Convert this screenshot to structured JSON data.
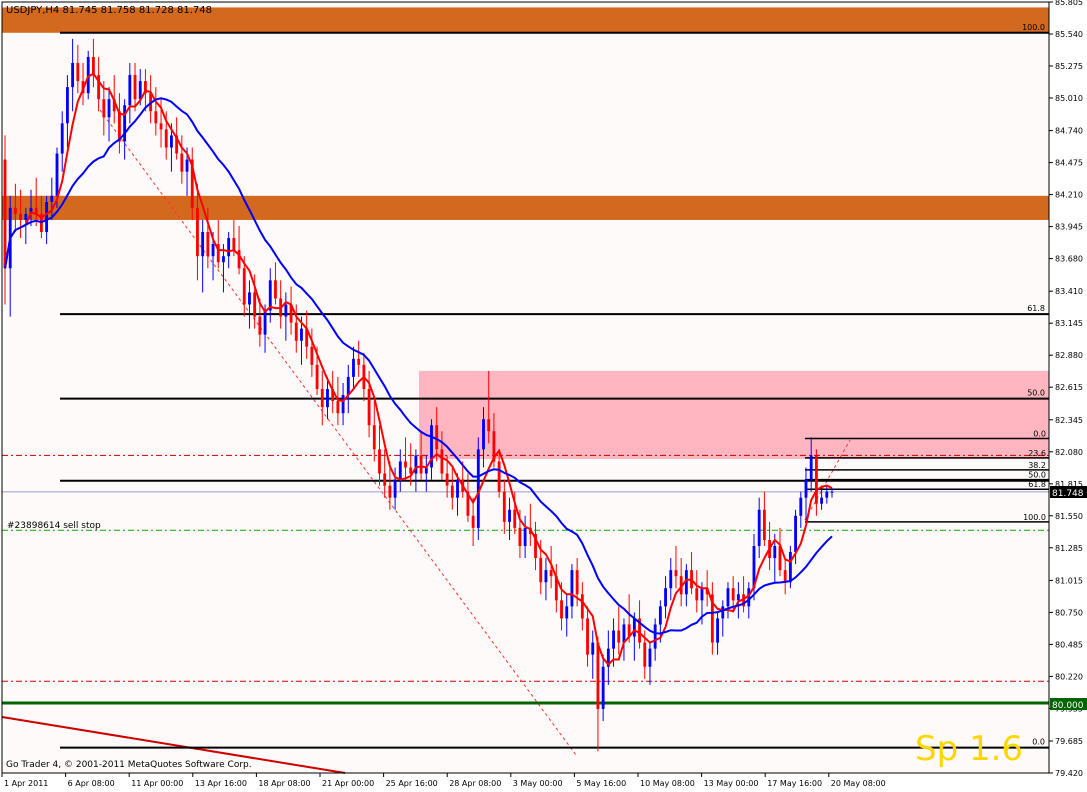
{
  "header": {
    "text": "USDJPY,H4  81.745 81.758 81.728 81.748"
  },
  "footer": {
    "text": "Go Trader 4, © 2001-2011 MetaQuotes Software Corp."
  },
  "watermark": {
    "text": "Sp 1.6"
  },
  "order_label": {
    "text": "#23898614 sell stop"
  },
  "current_price": {
    "text": "81.748"
  },
  "level_tag": {
    "text": "80.000"
  },
  "colors": {
    "background": "#fffafa",
    "bull": "#0000ff",
    "bear": "#ff0000",
    "ma_fast": "#ff0000",
    "ma_slow": "#0000ff",
    "zone_orange": "#d2691e",
    "zone_pink": "#ffb6c1",
    "support_green": "#006400",
    "watermark": "#ffd700"
  },
  "chart_data": {
    "type": "candlestick",
    "symbol": "USDJPY",
    "timeframe": "H4",
    "ylim": [
      79.42,
      85.805
    ],
    "y_ticks": [
      "85.805",
      "85.540",
      "85.275",
      "85.010",
      "84.740",
      "84.475",
      "84.210",
      "83.945",
      "83.680",
      "83.410",
      "83.145",
      "82.880",
      "82.615",
      "82.345",
      "82.080",
      "81.815",
      "81.550",
      "81.285",
      "81.015",
      "80.750",
      "80.485",
      "80.220",
      "79.955",
      "79.685",
      "79.420"
    ],
    "x_ticks": [
      "1 Apr 2011",
      "6 Apr 08:00",
      "11 Apr 00:00",
      "13 Apr 16:00",
      "18 Apr 08:00",
      "21 Apr 00:00",
      "25 Apr 16:00",
      "28 Apr 08:00",
      "3 May 00:00",
      "5 May 16:00",
      "10 May 08:00",
      "13 May 00:00",
      "17 May 16:00",
      "20 May 08:00"
    ],
    "ohlc": [
      [
        84.5,
        84.7,
        83.3,
        83.6
      ],
      [
        83.6,
        84.2,
        83.2,
        84.1
      ],
      [
        84.1,
        84.3,
        83.9,
        84.05
      ],
      [
        84.05,
        84.25,
        83.85,
        84.0
      ],
      [
        84.0,
        84.1,
        83.8,
        84.05
      ],
      [
        84.05,
        84.25,
        83.95,
        84.1
      ],
      [
        84.1,
        84.35,
        83.95,
        84.05
      ],
      [
        84.05,
        84.2,
        83.85,
        83.9
      ],
      [
        83.9,
        84.2,
        83.8,
        84.15
      ],
      [
        84.15,
        84.35,
        84.0,
        84.2
      ],
      [
        84.2,
        84.6,
        84.1,
        84.55
      ],
      [
        84.55,
        84.9,
        84.4,
        84.8
      ],
      [
        84.8,
        85.2,
        84.6,
        85.1
      ],
      [
        85.1,
        85.5,
        84.9,
        85.3
      ],
      [
        85.3,
        85.45,
        85.05,
        85.15
      ],
      [
        85.15,
        85.3,
        84.95,
        85.05
      ],
      [
        85.05,
        85.4,
        85.0,
        85.35
      ],
      [
        85.35,
        85.5,
        85.1,
        85.2
      ],
      [
        85.2,
        85.35,
        84.9,
        85.0
      ],
      [
        85.0,
        85.15,
        84.7,
        84.85
      ],
      [
        84.85,
        85.1,
        84.65,
        85.0
      ],
      [
        85.0,
        85.2,
        84.8,
        84.9
      ],
      [
        84.9,
        85.05,
        84.55,
        84.65
      ],
      [
        84.65,
        85.0,
        84.5,
        84.95
      ],
      [
        84.95,
        85.3,
        84.8,
        85.2
      ],
      [
        85.2,
        85.3,
        84.9,
        85.0
      ],
      [
        85.0,
        85.25,
        84.95,
        85.15
      ],
      [
        85.15,
        85.25,
        84.9,
        85.05
      ],
      [
        85.05,
        85.2,
        84.8,
        84.9
      ],
      [
        84.9,
        85.1,
        84.7,
        84.8
      ],
      [
        84.8,
        85.0,
        84.6,
        84.75
      ],
      [
        84.75,
        84.9,
        84.5,
        84.6
      ],
      [
        84.6,
        84.8,
        84.4,
        84.7
      ],
      [
        84.7,
        84.85,
        84.5,
        84.55
      ],
      [
        84.55,
        84.7,
        84.3,
        84.4
      ],
      [
        84.4,
        84.6,
        84.2,
        84.5
      ],
      [
        84.5,
        84.6,
        84.0,
        84.1
      ],
      [
        84.1,
        84.3,
        83.5,
        83.7
      ],
      [
        83.7,
        84.0,
        83.4,
        83.9
      ],
      [
        83.9,
        84.1,
        83.6,
        83.7
      ],
      [
        83.7,
        83.9,
        83.5,
        83.8
      ],
      [
        83.8,
        84.0,
        83.6,
        83.65
      ],
      [
        83.65,
        83.8,
        83.4,
        83.7
      ],
      [
        83.7,
        83.9,
        83.6,
        83.85
      ],
      [
        83.85,
        84.0,
        83.7,
        83.75
      ],
      [
        83.75,
        83.95,
        83.55,
        83.6
      ],
      [
        83.6,
        83.7,
        83.2,
        83.3
      ],
      [
        83.3,
        83.5,
        83.1,
        83.4
      ],
      [
        83.4,
        83.55,
        83.1,
        83.2
      ],
      [
        83.2,
        83.35,
        82.95,
        83.05
      ],
      [
        83.05,
        83.3,
        82.9,
        83.25
      ],
      [
        83.25,
        83.6,
        83.15,
        83.5
      ],
      [
        83.5,
        83.65,
        83.3,
        83.35
      ],
      [
        83.35,
        83.5,
        83.1,
        83.2
      ],
      [
        83.2,
        83.4,
        83.0,
        83.3
      ],
      [
        83.3,
        83.45,
        83.05,
        83.15
      ],
      [
        83.15,
        83.3,
        82.9,
        83.0
      ],
      [
        83.0,
        83.2,
        82.8,
        83.1
      ],
      [
        83.1,
        83.25,
        82.85,
        82.95
      ],
      [
        82.95,
        83.1,
        82.7,
        82.8
      ],
      [
        82.8,
        82.95,
        82.55,
        82.6
      ],
      [
        82.6,
        82.75,
        82.3,
        82.45
      ],
      [
        82.45,
        82.7,
        82.35,
        82.6
      ],
      [
        82.6,
        82.75,
        82.4,
        82.5
      ],
      [
        82.5,
        82.7,
        82.3,
        82.4
      ],
      [
        82.4,
        82.65,
        82.3,
        82.55
      ],
      [
        82.55,
        82.8,
        82.4,
        82.7
      ],
      [
        82.7,
        82.95,
        82.6,
        82.85
      ],
      [
        82.85,
        83.0,
        82.7,
        82.8
      ],
      [
        82.8,
        82.9,
        82.5,
        82.6
      ],
      [
        82.6,
        82.75,
        82.2,
        82.3
      ],
      [
        82.3,
        82.5,
        82.0,
        82.1
      ],
      [
        82.1,
        82.3,
        81.8,
        81.9
      ],
      [
        81.9,
        82.1,
        81.7,
        81.8
      ],
      [
        81.8,
        82.0,
        81.6,
        81.7
      ],
      [
        81.7,
        81.95,
        81.6,
        81.85
      ],
      [
        81.85,
        82.1,
        81.75,
        82.0
      ],
      [
        82.0,
        82.2,
        81.85,
        81.95
      ],
      [
        81.95,
        82.15,
        81.8,
        81.9
      ],
      [
        81.9,
        82.1,
        81.75,
        82.05
      ],
      [
        82.05,
        82.25,
        81.85,
        81.9
      ],
      [
        81.9,
        82.05,
        81.75,
        81.95
      ],
      [
        81.95,
        82.35,
        81.85,
        82.3
      ],
      [
        82.3,
        82.45,
        82.0,
        82.1
      ],
      [
        82.1,
        82.25,
        81.85,
        81.9
      ],
      [
        81.9,
        82.05,
        81.7,
        81.8
      ],
      [
        81.8,
        81.95,
        81.6,
        81.7
      ],
      [
        81.7,
        81.9,
        81.55,
        81.85
      ],
      [
        81.85,
        82.0,
        81.7,
        81.75
      ],
      [
        81.75,
        81.9,
        81.5,
        81.55
      ],
      [
        81.55,
        81.7,
        81.3,
        81.45
      ],
      [
        81.45,
        82.2,
        81.35,
        82.1
      ],
      [
        82.1,
        82.45,
        81.95,
        82.35
      ],
      [
        82.35,
        82.75,
        82.15,
        82.25
      ],
      [
        82.25,
        82.4,
        81.95,
        82.0
      ],
      [
        82.0,
        82.1,
        81.7,
        81.75
      ],
      [
        81.75,
        81.85,
        81.4,
        81.5
      ],
      [
        81.5,
        81.7,
        81.35,
        81.6
      ],
      [
        81.6,
        81.75,
        81.4,
        81.45
      ],
      [
        81.45,
        81.6,
        81.2,
        81.3
      ],
      [
        81.3,
        81.55,
        81.2,
        81.45
      ],
      [
        81.45,
        81.65,
        81.3,
        81.4
      ],
      [
        81.4,
        81.5,
        81.1,
        81.2
      ],
      [
        81.2,
        81.35,
        80.9,
        81.0
      ],
      [
        81.0,
        81.2,
        80.85,
        81.1
      ],
      [
        81.1,
        81.3,
        80.95,
        81.05
      ],
      [
        81.05,
        81.15,
        80.75,
        80.85
      ],
      [
        80.85,
        81.0,
        80.6,
        80.7
      ],
      [
        80.7,
        80.9,
        80.55,
        80.8
      ],
      [
        80.8,
        81.15,
        80.7,
        81.1
      ],
      [
        81.1,
        81.2,
        80.8,
        80.9
      ],
      [
        80.9,
        81.0,
        80.6,
        80.7
      ],
      [
        80.7,
        80.8,
        80.3,
        80.4
      ],
      [
        80.4,
        80.6,
        80.2,
        80.5
      ],
      [
        80.5,
        80.55,
        79.6,
        79.95
      ],
      [
        79.95,
        80.4,
        79.85,
        80.3
      ],
      [
        80.3,
        80.6,
        80.15,
        80.45
      ],
      [
        80.45,
        80.7,
        80.3,
        80.6
      ],
      [
        80.6,
        80.8,
        80.4,
        80.5
      ],
      [
        80.5,
        80.7,
        80.35,
        80.65
      ],
      [
        80.65,
        80.9,
        80.5,
        80.55
      ],
      [
        80.55,
        80.75,
        80.35,
        80.7
      ],
      [
        80.7,
        80.85,
        80.45,
        80.5
      ],
      [
        80.5,
        80.6,
        80.2,
        80.3
      ],
      [
        80.3,
        80.5,
        80.15,
        80.45
      ],
      [
        80.45,
        80.7,
        80.35,
        80.65
      ],
      [
        80.65,
        80.85,
        80.5,
        80.8
      ],
      [
        80.8,
        81.05,
        80.7,
        80.95
      ],
      [
        80.95,
        81.2,
        80.85,
        81.1
      ],
      [
        81.1,
        81.3,
        80.95,
        81.05
      ],
      [
        81.05,
        81.2,
        80.8,
        80.9
      ],
      [
        80.9,
        81.15,
        80.8,
        81.1
      ],
      [
        81.1,
        81.25,
        80.9,
        80.95
      ],
      [
        80.95,
        81.1,
        80.75,
        80.85
      ],
      [
        80.85,
        81.0,
        80.65,
        80.95
      ],
      [
        80.95,
        81.1,
        80.8,
        80.9
      ],
      [
        80.9,
        81.0,
        80.4,
        80.5
      ],
      [
        80.5,
        80.75,
        80.4,
        80.7
      ],
      [
        80.7,
        80.85,
        80.55,
        80.8
      ],
      [
        80.8,
        81.0,
        80.7,
        80.95
      ],
      [
        80.95,
        81.05,
        80.75,
        80.85
      ],
      [
        80.85,
        81.0,
        80.7,
        80.9
      ],
      [
        80.9,
        81.05,
        80.75,
        80.8
      ],
      [
        80.8,
        81.0,
        80.7,
        80.95
      ],
      [
        80.95,
        81.4,
        80.85,
        81.3
      ],
      [
        81.3,
        81.7,
        81.2,
        81.6
      ],
      [
        81.6,
        81.75,
        81.3,
        81.35
      ],
      [
        81.35,
        81.5,
        81.1,
        81.2
      ],
      [
        81.2,
        81.4,
        81.0,
        81.3
      ],
      [
        81.3,
        81.45,
        81.05,
        81.1
      ],
      [
        81.1,
        81.2,
        80.9,
        81.0
      ],
      [
        81.0,
        81.3,
        80.95,
        81.25
      ],
      [
        81.25,
        81.6,
        81.15,
        81.55
      ],
      [
        81.55,
        81.75,
        81.45,
        81.7
      ],
      [
        81.7,
        81.95,
        81.5,
        81.85
      ],
      [
        81.85,
        82.2,
        81.75,
        82.05
      ],
      [
        82.05,
        82.1,
        81.55,
        81.65
      ],
      [
        81.65,
        81.8,
        81.6,
        81.7
      ],
      [
        81.7,
        81.8,
        81.65,
        81.75
      ],
      [
        81.75,
        81.78,
        81.7,
        81.75
      ]
    ],
    "ma_fast_period": 5,
    "ma_slow_period": 20,
    "horizontal_levels": [
      {
        "price": 85.55,
        "label": "100.0"
      },
      {
        "price": 83.22,
        "label": "61.8"
      },
      {
        "price": 82.52,
        "label": "50.0"
      },
      {
        "price": 81.84,
        "label": ""
      },
      {
        "price": 79.63,
        "label": "0.0"
      }
    ],
    "fib_small": [
      {
        "price": 82.19,
        "label": "0.0"
      },
      {
        "price": 82.03,
        "label": "23.6"
      },
      {
        "price": 81.93,
        "label": "38.2"
      },
      {
        "price": 81.85,
        "label": "50.0"
      },
      {
        "price": 81.77,
        "label": "61.8"
      },
      {
        "price": 81.5,
        "label": "100.0"
      }
    ],
    "zones": [
      {
        "from": 85.55,
        "to": 85.76,
        "color": "orange"
      },
      {
        "from": 84.0,
        "to": 84.2,
        "color": "orange"
      },
      {
        "from": 82.02,
        "to": 82.75,
        "color": "pink"
      }
    ],
    "dashed_levels": [
      {
        "price": 82.05,
        "color": "red"
      },
      {
        "price": 81.43,
        "color": "green"
      },
      {
        "price": 80.18,
        "color": "red"
      }
    ],
    "support_level": 80.0,
    "current_price": 81.748
  }
}
